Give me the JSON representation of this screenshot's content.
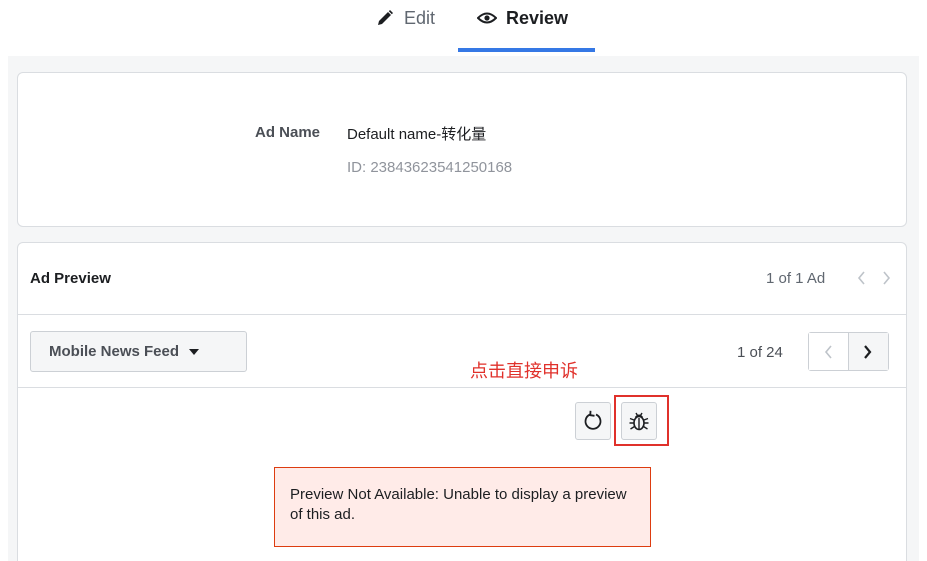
{
  "tabs": [
    {
      "label": "Edit",
      "icon": "pencil-icon",
      "active": false
    },
    {
      "label": "Review",
      "icon": "eye-icon",
      "active": true
    }
  ],
  "ad": {
    "name_label": "Ad Name",
    "name_value": "Default name-转化量",
    "id_text": "ID: 23843623541250168"
  },
  "preview": {
    "title": "Ad Preview",
    "count_text": "1 of 1 Ad",
    "placement_label": "Mobile News Feed",
    "page_text": "1 of 24",
    "annotation": "点击直接申诉",
    "error_text": "Preview Not Available: Unable to display a preview of this ad."
  },
  "colors": {
    "accent": "#3578e5",
    "annotation_red": "#e0312b",
    "error_bg": "#ffebe8"
  }
}
